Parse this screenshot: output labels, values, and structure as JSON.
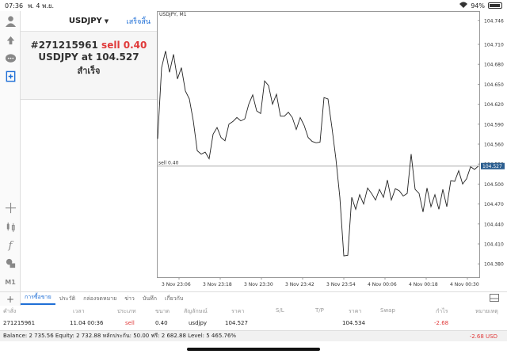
{
  "status": {
    "time": "07:36",
    "date": "พ. 4 พ.ย.",
    "battery": "94%"
  },
  "order": {
    "symbol": "USDJPY",
    "done": "เสร็จสิ้น",
    "ticket": "#271215961",
    "action": "sell 0.40",
    "at_text": "USDJPY at",
    "price": "104.527",
    "result": "สำเร็จ"
  },
  "chart": {
    "title": "USDJPY, M1",
    "line_label": "sell 0.40"
  },
  "chart_data": {
    "type": "line",
    "title": "USDJPY, M1",
    "xlabel": "",
    "ylabel": "",
    "ylim": [
      104.36,
      104.76
    ],
    "y_ticks": [
      "104.746",
      "104.710",
      "104.680",
      "104.650",
      "104.620",
      "104.590",
      "104.560",
      "104.530",
      "104.500",
      "104.470",
      "104.440",
      "104.410",
      "104.380"
    ],
    "x_ticks": [
      "3 Nov 23:06",
      "3 Nov 23:18",
      "3 Nov 23:30",
      "3 Nov 23:42",
      "3 Nov 23:54",
      "4 Nov 00:06",
      "4 Nov 00:18",
      "4 Nov 00:30"
    ],
    "current_price": "104.527",
    "sell_level": 104.527,
    "series": [
      {
        "values": [
          104.568,
          104.675,
          104.7,
          104.668,
          104.695,
          104.658,
          104.675,
          104.64,
          104.628,
          104.595,
          104.55,
          104.545,
          104.548,
          104.538,
          104.575,
          104.585,
          104.57,
          104.565,
          104.59,
          104.594,
          104.6,
          104.595,
          104.598,
          104.62,
          104.634,
          104.61,
          104.606,
          104.655,
          104.648,
          104.62,
          104.635,
          104.602,
          104.602,
          104.608,
          104.6,
          104.582,
          104.6,
          104.588,
          104.57,
          104.564,
          104.562,
          104.563,
          104.63,
          104.628,
          104.585,
          104.538,
          104.48,
          104.392,
          104.393,
          104.48,
          104.462,
          104.484,
          104.47,
          104.494,
          104.486,
          104.476,
          104.492,
          104.48,
          104.506,
          104.476,
          104.493,
          104.49,
          104.482,
          104.486,
          104.545,
          104.492,
          104.486,
          104.458,
          104.494,
          104.466,
          104.484,
          104.462,
          104.492,
          104.466,
          104.505,
          104.504,
          104.52,
          104.5,
          104.508,
          104.526,
          104.522,
          104.527
        ]
      }
    ]
  },
  "tabs": {
    "items": [
      {
        "label": "การซื้อขาย",
        "active": true
      },
      {
        "label": "ประวัติ",
        "active": false
      },
      {
        "label": "กล่องจดหมาย",
        "active": false
      },
      {
        "label": "ข่าว",
        "active": false
      },
      {
        "label": "บันทึก",
        "active": false
      },
      {
        "label": "เกี่ยวกับ",
        "active": false
      }
    ]
  },
  "table": {
    "headers": [
      "คำสั่ง",
      "เวลา",
      "ประเภท",
      "ขนาด",
      "สัญลักษณ์",
      "ราคา",
      "S/L",
      "T/P",
      "ราคา",
      "Swap",
      "กำไร",
      "หมายเหตุ"
    ],
    "row": [
      "271215961",
      "11.04 00:36",
      "sell",
      "0.40",
      "usdjpy",
      "104.527",
      "",
      "",
      "104.534",
      "",
      "-2.68",
      ""
    ]
  },
  "balance": {
    "text": "Balance: 2 735.56 Equity: 2 732.88 หลักประกัน: 50.00 ฟรี: 2 682.88 Level: 5 465.76%",
    "profit": "-2.68  USD"
  },
  "colors": {
    "accent": "#1f6fd6",
    "sell": "#e03a3a"
  }
}
